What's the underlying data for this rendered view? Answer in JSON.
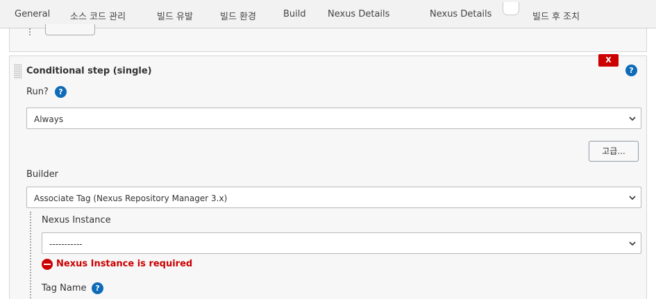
{
  "tabs": [
    {
      "label": "General"
    },
    {
      "label": "소스 코드 관리"
    },
    {
      "label": "빌드 유발"
    },
    {
      "label": "빌드 환경"
    },
    {
      "label": "Build"
    },
    {
      "label": "Nexus Details"
    },
    {
      "label": "Nexus Details"
    },
    {
      "label": "빌드 후 조치"
    }
  ],
  "step": {
    "title": "Conditional step (single)",
    "delete_label": "X",
    "help_glyph": "?",
    "run": {
      "label": "Run?",
      "selected": "Always"
    },
    "advanced_label": "고급...",
    "builder": {
      "label": "Builder",
      "selected": "Associate Tag (Nexus Repository Manager 3.x)"
    },
    "nexus_instance": {
      "label": "Nexus Instance",
      "selected": "-----------",
      "error": "Nexus Instance is required"
    },
    "tag_name": {
      "label": "Tag Name"
    }
  },
  "colors": {
    "error": "#cc0000",
    "help": "#0e6bb7",
    "delete": "#cc0000"
  }
}
